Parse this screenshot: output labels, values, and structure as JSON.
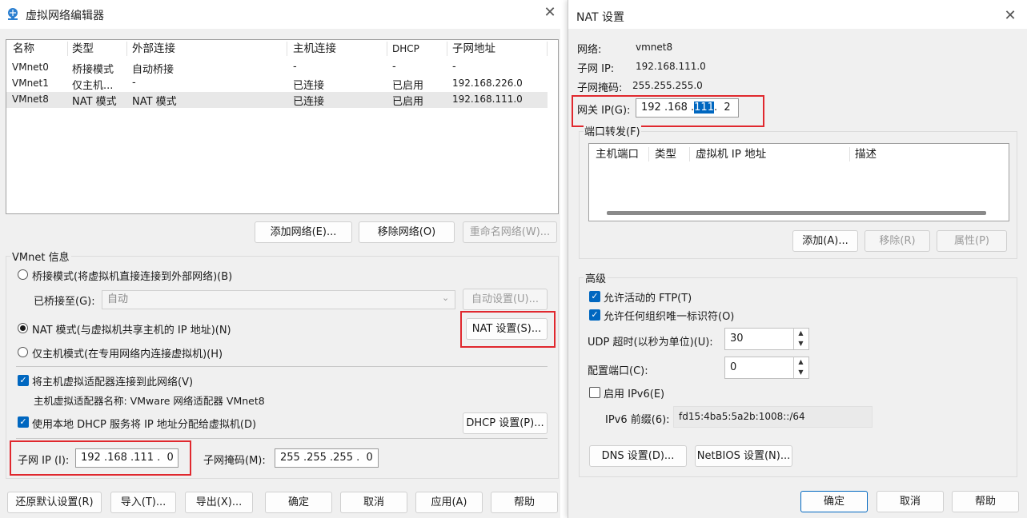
{
  "editor": {
    "title": "虚拟网络编辑器",
    "columns": [
      "名称",
      "类型",
      "外部连接",
      "主机连接",
      "DHCP",
      "子网地址"
    ],
    "rows": [
      [
        "VMnet0",
        "桥接模式",
        "自动桥接",
        "-",
        "-",
        "-"
      ],
      [
        "VMnet1",
        "仅主机...",
        "-",
        "已连接",
        "已启用",
        "192.168.226.0"
      ],
      [
        "VMnet8",
        "NAT 模式",
        "NAT 模式",
        "已连接",
        "已启用",
        "192.168.111.0"
      ]
    ],
    "add_network": "添加网络(E)...",
    "remove_network": "移除网络(O)",
    "rename_network": "重命名网络(W)...",
    "vmnet_info": "VMnet 信息",
    "bridge_mode": "桥接模式(将虚拟机直接连接到外部网络)(B)",
    "bridged_to_label": "已桥接至(G):",
    "bridged_to_value": "自动",
    "auto_settings": "自动设置(U)...",
    "nat_mode": "NAT 模式(与虚拟机共享主机的 IP 地址)(N)",
    "nat_settings": "NAT 设置(S)...",
    "host_only": "仅主机模式(在专用网络内连接虚拟机)(H)",
    "connect_adapter": "将主机虚拟适配器连接到此网络(V)",
    "adapter_name": "主机虚拟适配器名称: VMware 网络适配器 VMnet8",
    "use_dhcp": "使用本地 DHCP 服务将 IP 地址分配给虚拟机(D)",
    "dhcp_settings": "DHCP 设置(P)...",
    "subnet_ip_label": "子网 IP (I):",
    "subnet_ip_value": "192 .168 .111 .  0",
    "subnet_mask_label": "子网掩码(M):",
    "subnet_mask_value": "255 .255 .255 .  0",
    "restore_defaults": "还原默认设置(R)",
    "import": "导入(T)...",
    "export": "导出(X)...",
    "ok": "确定",
    "cancel": "取消",
    "apply": "应用(A)",
    "help": "帮助"
  },
  "nat": {
    "title": "NAT 设置",
    "network_label": "网络:",
    "network_value": "vmnet8",
    "subnet_ip_label": "子网 IP:",
    "subnet_ip_value": "192.168.111.0",
    "subnet_mask_label": "子网掩码:",
    "subnet_mask_value": "255.255.255.0",
    "gateway_label": "网关 IP(G):",
    "gateway_a": "192 .168 .",
    "gateway_b": "111",
    "gateway_c": ".  2",
    "port_forwarding": "端口转发(F)",
    "pf_columns": [
      "主机端口",
      "类型",
      "虚拟机 IP 地址",
      "描述"
    ],
    "add": "添加(A)...",
    "remove": "移除(R)",
    "properties": "属性(P)",
    "advanced": "高级",
    "allow_ftp": "允许活动的 FTP(T)",
    "allow_oui": "允许任何组织唯一标识符(O)",
    "udp_timeout_label": "UDP 超时(以秒为单位)(U):",
    "udp_timeout_value": "30",
    "config_port_label": "配置端口(C):",
    "config_port_value": "0",
    "enable_ipv6": "启用 IPv6(E)",
    "ipv6_prefix_label": "IPv6 前缀(6):",
    "ipv6_prefix_value": "fd15:4ba5:5a2b:1008::/64",
    "dns_settings": "DNS 设置(D)...",
    "netbios_settings": "NetBIOS 设置(N)...",
    "ok": "确定",
    "cancel": "取消",
    "help": "帮助"
  },
  "colors": {
    "accent": "#0067c0",
    "highlight": "#e0282e"
  }
}
